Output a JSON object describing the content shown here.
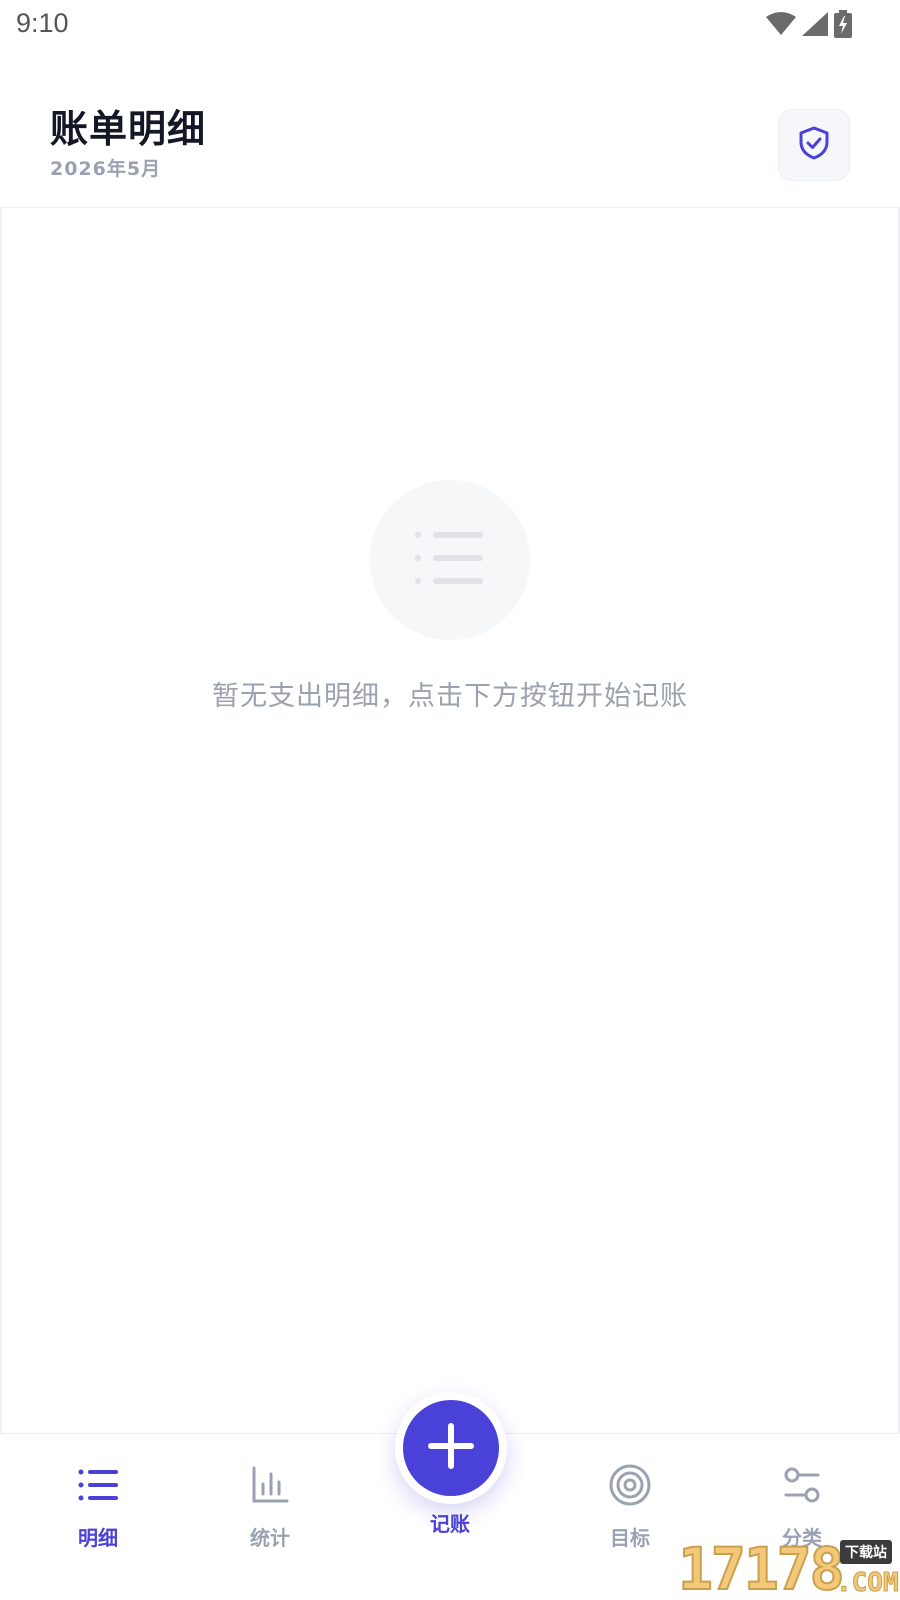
{
  "status_bar": {
    "time": "9:10",
    "icons": [
      "wifi-icon",
      "signal-icon",
      "battery-charging-icon"
    ]
  },
  "header": {
    "title": "账单明细",
    "subtitle": "2026年5月",
    "action_icon": "shield-check-icon"
  },
  "empty_state": {
    "icon": "list-icon",
    "message": "暂无支出明细，点击下方按钮开始记账"
  },
  "bottom_nav": {
    "items": [
      {
        "label": "明细",
        "icon": "list-icon",
        "active": true
      },
      {
        "label": "统计",
        "icon": "bar-chart-icon",
        "active": false
      },
      {
        "label": "记账",
        "icon": "plus-icon",
        "active": false
      },
      {
        "label": "目标",
        "icon": "target-icon",
        "active": false
      },
      {
        "label": "分类",
        "icon": "sliders-icon",
        "active": false
      }
    ]
  },
  "colors": {
    "accent": "#4a41d8",
    "muted_text": "#9aa1b1",
    "title_text": "#141826"
  },
  "watermark": {
    "digits": "17178",
    "badge": "下载站",
    "suffix": ".COM"
  }
}
